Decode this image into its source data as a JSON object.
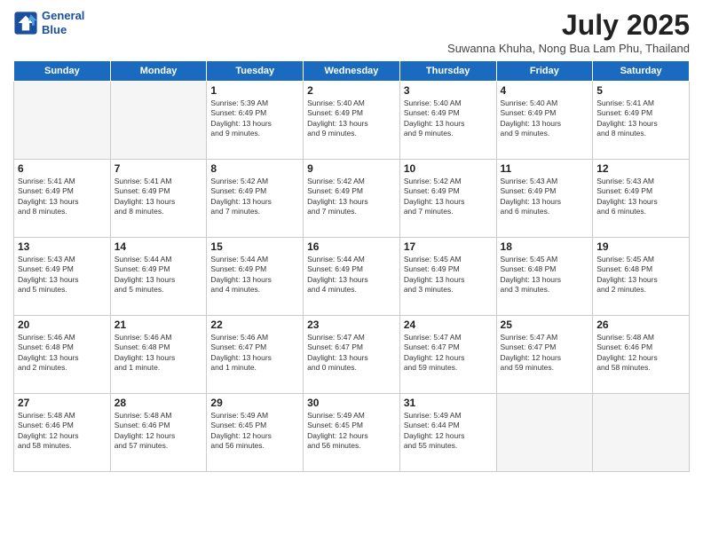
{
  "title": "July 2025",
  "subtitle": "Suwanna Khuha, Nong Bua Lam Phu, Thailand",
  "logo": {
    "line1": "General",
    "line2": "Blue"
  },
  "days": [
    "Sunday",
    "Monday",
    "Tuesday",
    "Wednesday",
    "Thursday",
    "Friday",
    "Saturday"
  ],
  "weeks": [
    [
      {
        "day": "",
        "text": ""
      },
      {
        "day": "",
        "text": ""
      },
      {
        "day": "1",
        "text": "Sunrise: 5:39 AM\nSunset: 6:49 PM\nDaylight: 13 hours\nand 9 minutes."
      },
      {
        "day": "2",
        "text": "Sunrise: 5:40 AM\nSunset: 6:49 PM\nDaylight: 13 hours\nand 9 minutes."
      },
      {
        "day": "3",
        "text": "Sunrise: 5:40 AM\nSunset: 6:49 PM\nDaylight: 13 hours\nand 9 minutes."
      },
      {
        "day": "4",
        "text": "Sunrise: 5:40 AM\nSunset: 6:49 PM\nDaylight: 13 hours\nand 9 minutes."
      },
      {
        "day": "5",
        "text": "Sunrise: 5:41 AM\nSunset: 6:49 PM\nDaylight: 13 hours\nand 8 minutes."
      }
    ],
    [
      {
        "day": "6",
        "text": "Sunrise: 5:41 AM\nSunset: 6:49 PM\nDaylight: 13 hours\nand 8 minutes."
      },
      {
        "day": "7",
        "text": "Sunrise: 5:41 AM\nSunset: 6:49 PM\nDaylight: 13 hours\nand 8 minutes."
      },
      {
        "day": "8",
        "text": "Sunrise: 5:42 AM\nSunset: 6:49 PM\nDaylight: 13 hours\nand 7 minutes."
      },
      {
        "day": "9",
        "text": "Sunrise: 5:42 AM\nSunset: 6:49 PM\nDaylight: 13 hours\nand 7 minutes."
      },
      {
        "day": "10",
        "text": "Sunrise: 5:42 AM\nSunset: 6:49 PM\nDaylight: 13 hours\nand 7 minutes."
      },
      {
        "day": "11",
        "text": "Sunrise: 5:43 AM\nSunset: 6:49 PM\nDaylight: 13 hours\nand 6 minutes."
      },
      {
        "day": "12",
        "text": "Sunrise: 5:43 AM\nSunset: 6:49 PM\nDaylight: 13 hours\nand 6 minutes."
      }
    ],
    [
      {
        "day": "13",
        "text": "Sunrise: 5:43 AM\nSunset: 6:49 PM\nDaylight: 13 hours\nand 5 minutes."
      },
      {
        "day": "14",
        "text": "Sunrise: 5:44 AM\nSunset: 6:49 PM\nDaylight: 13 hours\nand 5 minutes."
      },
      {
        "day": "15",
        "text": "Sunrise: 5:44 AM\nSunset: 6:49 PM\nDaylight: 13 hours\nand 4 minutes."
      },
      {
        "day": "16",
        "text": "Sunrise: 5:44 AM\nSunset: 6:49 PM\nDaylight: 13 hours\nand 4 minutes."
      },
      {
        "day": "17",
        "text": "Sunrise: 5:45 AM\nSunset: 6:49 PM\nDaylight: 13 hours\nand 3 minutes."
      },
      {
        "day": "18",
        "text": "Sunrise: 5:45 AM\nSunset: 6:48 PM\nDaylight: 13 hours\nand 3 minutes."
      },
      {
        "day": "19",
        "text": "Sunrise: 5:45 AM\nSunset: 6:48 PM\nDaylight: 13 hours\nand 2 minutes."
      }
    ],
    [
      {
        "day": "20",
        "text": "Sunrise: 5:46 AM\nSunset: 6:48 PM\nDaylight: 13 hours\nand 2 minutes."
      },
      {
        "day": "21",
        "text": "Sunrise: 5:46 AM\nSunset: 6:48 PM\nDaylight: 13 hours\nand 1 minute."
      },
      {
        "day": "22",
        "text": "Sunrise: 5:46 AM\nSunset: 6:47 PM\nDaylight: 13 hours\nand 1 minute."
      },
      {
        "day": "23",
        "text": "Sunrise: 5:47 AM\nSunset: 6:47 PM\nDaylight: 13 hours\nand 0 minutes."
      },
      {
        "day": "24",
        "text": "Sunrise: 5:47 AM\nSunset: 6:47 PM\nDaylight: 12 hours\nand 59 minutes."
      },
      {
        "day": "25",
        "text": "Sunrise: 5:47 AM\nSunset: 6:47 PM\nDaylight: 12 hours\nand 59 minutes."
      },
      {
        "day": "26",
        "text": "Sunrise: 5:48 AM\nSunset: 6:46 PM\nDaylight: 12 hours\nand 58 minutes."
      }
    ],
    [
      {
        "day": "27",
        "text": "Sunrise: 5:48 AM\nSunset: 6:46 PM\nDaylight: 12 hours\nand 58 minutes."
      },
      {
        "day": "28",
        "text": "Sunrise: 5:48 AM\nSunset: 6:46 PM\nDaylight: 12 hours\nand 57 minutes."
      },
      {
        "day": "29",
        "text": "Sunrise: 5:49 AM\nSunset: 6:45 PM\nDaylight: 12 hours\nand 56 minutes."
      },
      {
        "day": "30",
        "text": "Sunrise: 5:49 AM\nSunset: 6:45 PM\nDaylight: 12 hours\nand 56 minutes."
      },
      {
        "day": "31",
        "text": "Sunrise: 5:49 AM\nSunset: 6:44 PM\nDaylight: 12 hours\nand 55 minutes."
      },
      {
        "day": "",
        "text": ""
      },
      {
        "day": "",
        "text": ""
      }
    ]
  ]
}
